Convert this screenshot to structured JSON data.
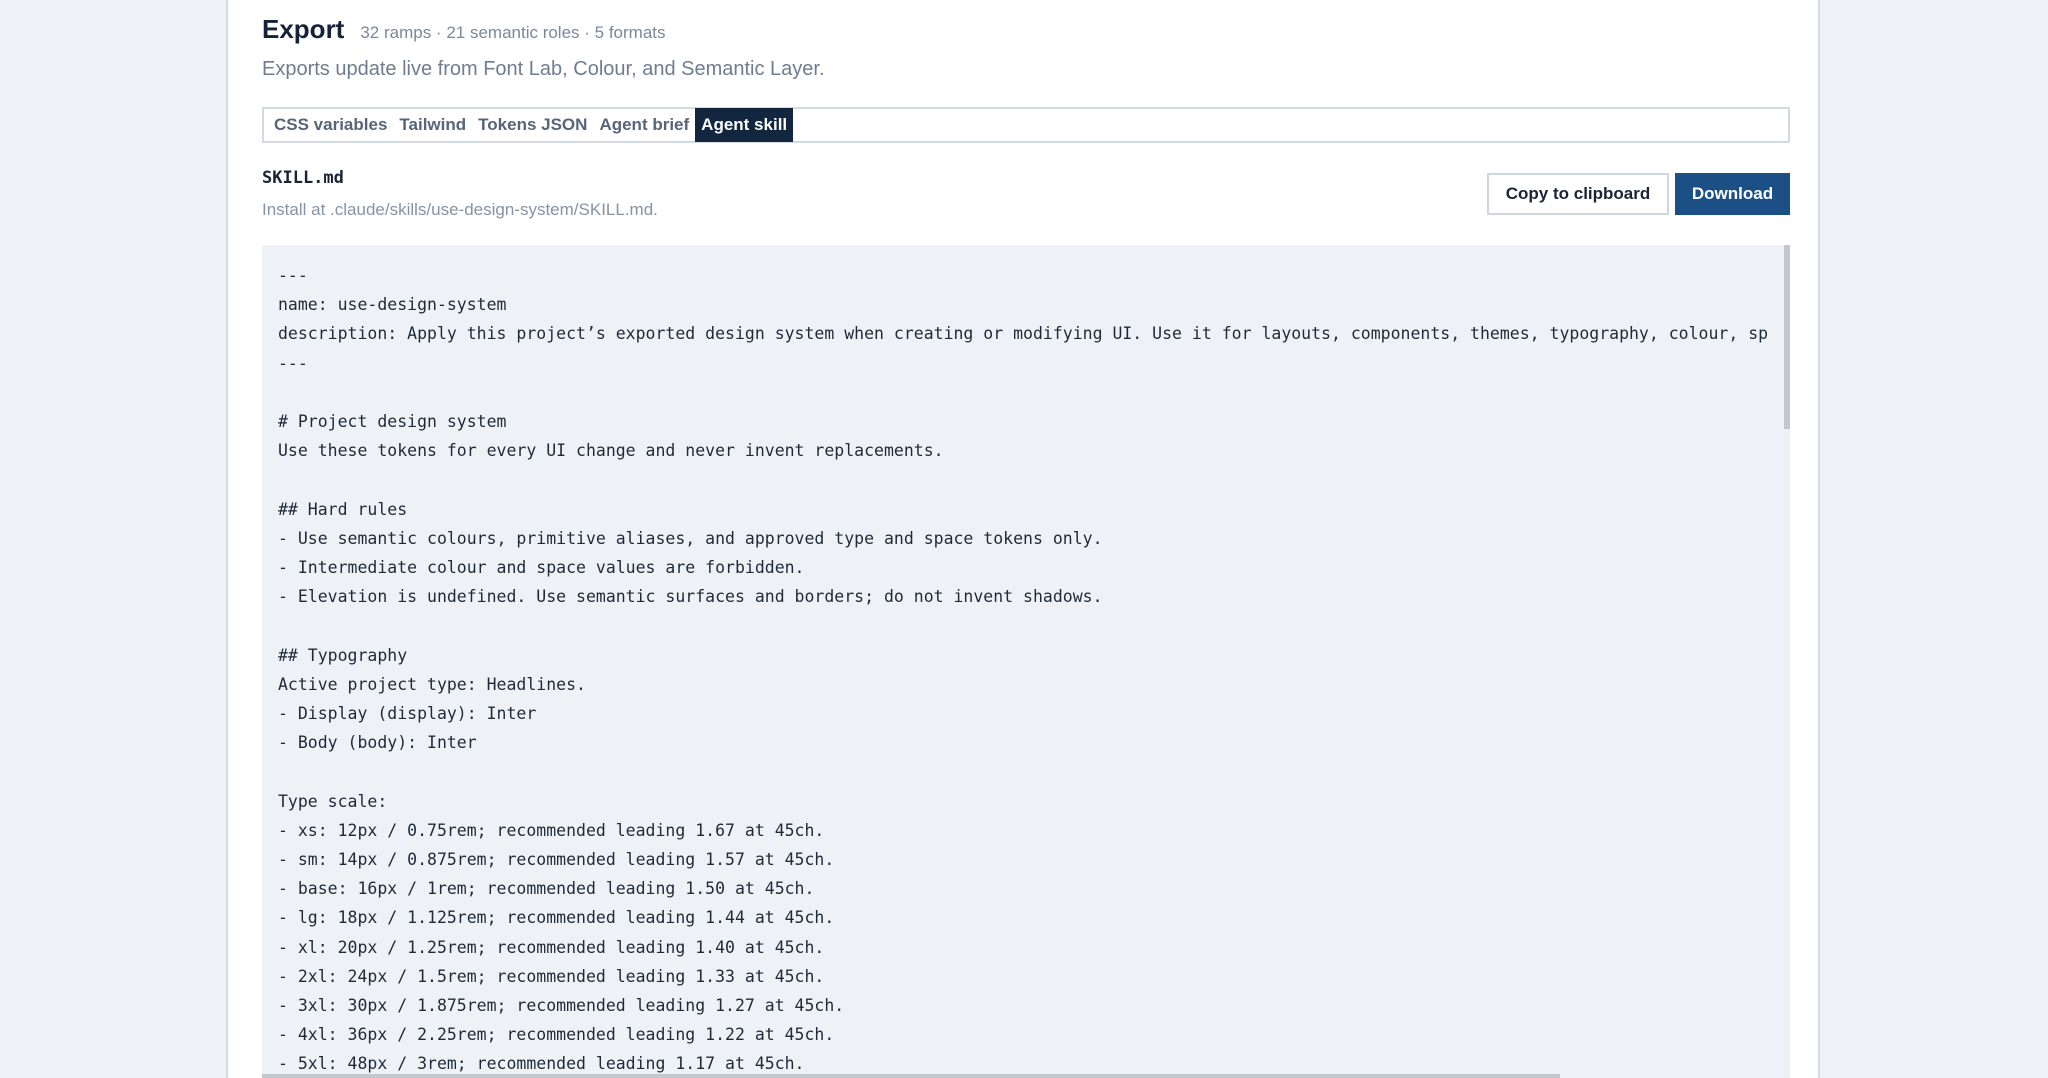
{
  "export": {
    "title": "Export",
    "meta": "32 ramps · 21 semantic roles · 5 formats",
    "subtitle": "Exports update live from Font Lab, Colour, and Semantic Layer."
  },
  "tabs": [
    {
      "label": "CSS variables",
      "active": false
    },
    {
      "label": "Tailwind",
      "active": false
    },
    {
      "label": "Tokens JSON",
      "active": false
    },
    {
      "label": "Agent brief",
      "active": false
    },
    {
      "label": "Agent skill",
      "active": true
    }
  ],
  "file": {
    "name": "SKILL.md",
    "install_hint": "Install at .claude/skills/use-design-system/SKILL.md."
  },
  "actions": {
    "copy_label": "Copy to clipboard",
    "download_label": "Download"
  },
  "code_lines": [
    "---",
    "name: use-design-system",
    "description: Apply this project’s exported design system when creating or modifying UI. Use it for layouts, components, themes, typography, colour, sp",
    "---",
    "",
    "# Project design system",
    "Use these tokens for every UI change and never invent replacements.",
    "",
    "## Hard rules",
    "- Use semantic colours, primitive aliases, and approved type and space tokens only.",
    "- Intermediate colour and space values are forbidden.",
    "- Elevation is undefined. Use semantic surfaces and borders; do not invent shadows.",
    "",
    "## Typography",
    "Active project type: Headlines.",
    "- Display (display): Inter",
    "- Body (body): Inter",
    "",
    "Type scale:",
    "- xs: 12px / 0.75rem; recommended leading 1.67 at 45ch.",
    "- sm: 14px / 0.875rem; recommended leading 1.57 at 45ch.",
    "- base: 16px / 1rem; recommended leading 1.50 at 45ch.",
    "- lg: 18px / 1.125rem; recommended leading 1.44 at 45ch.",
    "- xl: 20px / 1.25rem; recommended leading 1.40 at 45ch.",
    "- 2xl: 24px / 1.5rem; recommended leading 1.33 at 45ch.",
    "- 3xl: 30px / 1.875rem; recommended leading 1.27 at 45ch.",
    "- 4xl: 36px / 2.25rem; recommended leading 1.22 at 45ch.",
    "- 5xl: 48px / 3rem; recommended leading 1.17 at 45ch."
  ]
}
